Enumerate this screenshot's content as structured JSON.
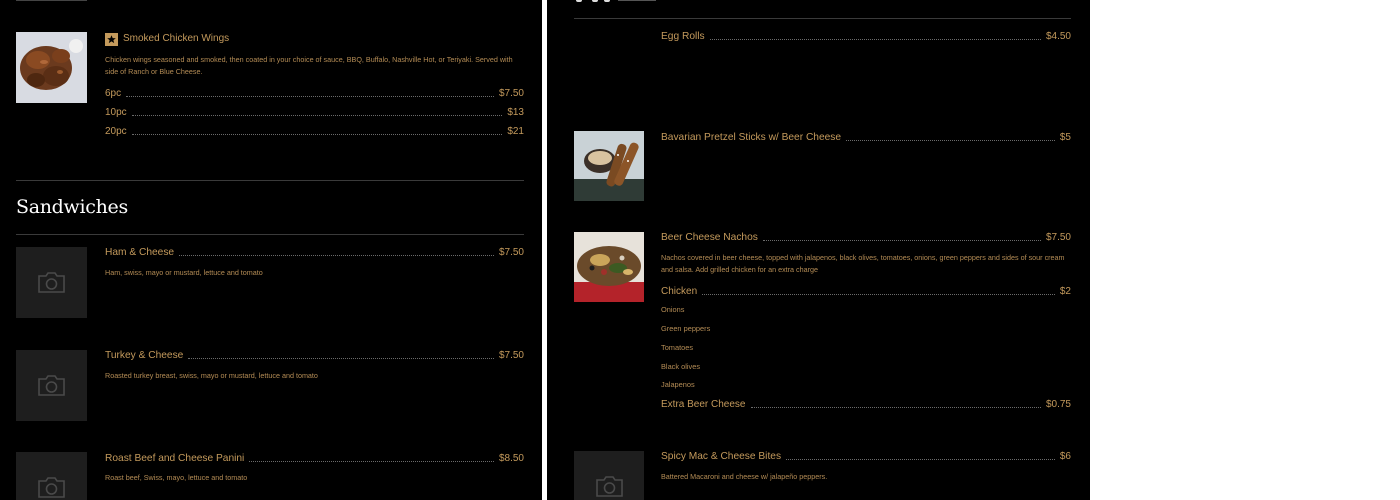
{
  "left_panel": {
    "wings": {
      "title": "Smoked Chicken Wings",
      "badge_icon": "star-icon",
      "description": "Chicken wings seasoned and smoked, then coated in your choice of sauce, BBQ, Buffalo, Nashville Hot, or Teriyaki. Served with side of Ranch or Blue Cheese.",
      "options": [
        {
          "label": "6pc",
          "price": "$7.50"
        },
        {
          "label": "10pc",
          "price": "$13"
        },
        {
          "label": "20pc",
          "price": "$21"
        }
      ]
    },
    "sandwiches": {
      "heading": "Sandwiches",
      "items": [
        {
          "name": "Ham & Cheese",
          "price": "$7.50",
          "description": "Ham, swiss, mayo or mustard, lettuce and tomato"
        },
        {
          "name": "Turkey & Cheese",
          "price": "$7.50",
          "description": "Roasted turkey breast, swiss, mayo or mustard, lettuce and tomato"
        },
        {
          "name": "Roast Beef and Cheese Panini",
          "price": "$8.50",
          "description": "Roast beef, Swiss, mayo, lettuce and tomato"
        }
      ]
    }
  },
  "right_panel": {
    "items": [
      {
        "name": "Egg Rolls",
        "price": "$4.50"
      },
      {
        "name": "Bavarian Pretzel Sticks w/ Beer Cheese",
        "price": "$5"
      },
      {
        "name": "Beer Cheese Nachos",
        "price": "$7.50",
        "description": "Nachos covered in beer cheese, topped with jalapenos, black olives, tomatoes, onions, green peppers and sides of sour cream and salsa. Add grilled chicken for an extra charge",
        "addons": [
          {
            "label": "Chicken",
            "price": "$2"
          },
          {
            "label": "Onions",
            "price": ""
          },
          {
            "label": "Green peppers",
            "price": ""
          },
          {
            "label": "Tomatoes",
            "price": ""
          },
          {
            "label": "Black olives",
            "price": ""
          },
          {
            "label": "Jalapenos",
            "price": ""
          },
          {
            "label": "Extra Beer Cheese",
            "price": "$0.75"
          }
        ]
      },
      {
        "name": "Spicy Mac & Cheese Bites",
        "price": "$6",
        "description": "Battered Macaroni and cheese w/ jalapeño peppers."
      }
    ]
  },
  "colors": {
    "background": "#000000",
    "accent": "#c49a5c",
    "text_muted": "#b48c55",
    "heading": "#ffffff"
  }
}
